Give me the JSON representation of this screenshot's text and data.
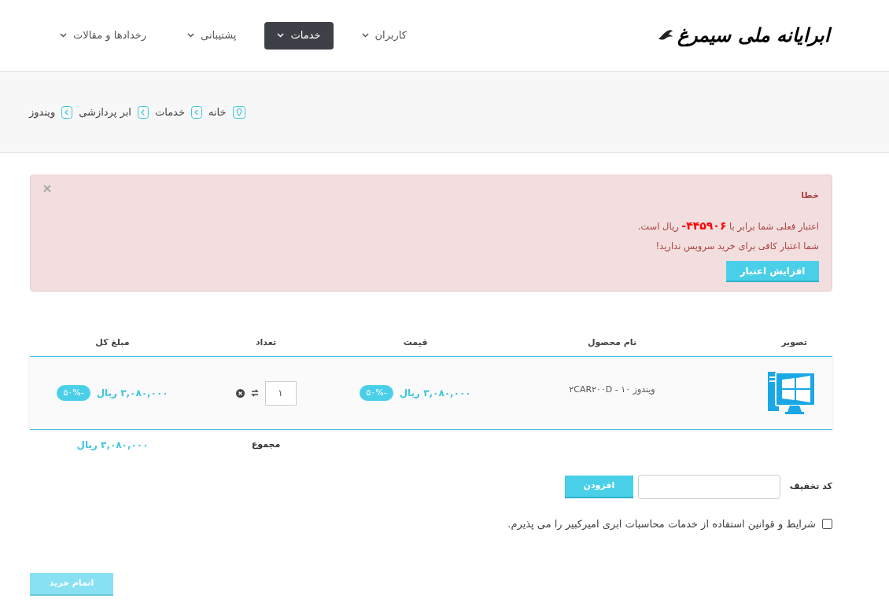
{
  "logo": {
    "text": "ابرایانه ملی سیمرغ"
  },
  "nav": [
    {
      "label": "کاربران",
      "selected": false
    },
    {
      "label": "خدمات",
      "selected": true
    },
    {
      "label": "پشتیبانی",
      "selected": false
    },
    {
      "label": "رخدادها و مقالات",
      "selected": false
    }
  ],
  "breadcrumb": [
    "خانه",
    "خدمات",
    "ابر پردازشی",
    "ویندوز"
  ],
  "alert": {
    "title": "خطا",
    "lines": [
      "اعتبار فعلی شما برابر با **۴۴۵۹۰۶-** ریال است.",
      "شما اعتبار کافی برای خرید سرویس ندارید!"
    ],
    "button": "افزایش اعتبار"
  },
  "table": {
    "columns": [
      "تصویر",
      "نام محصول",
      "قیمت",
      "تعداد",
      "مبلغ کل"
    ],
    "rows": [
      {
        "product": "ویندوز ۱۰ - ۲CAR۲۰۰D",
        "price": "۳,۰۸۰,۰۰۰ ریال",
        "price_badge": "-۵۰%",
        "quantity": "۱",
        "total": "۳,۰۸۰,۰۰۰ ریال",
        "total_badge": "-۵۰%"
      }
    ],
    "sum_label": "مجموع",
    "sum": "۳,۰۸۰,۰۰۰ ریال"
  },
  "discount": {
    "label": "کد تخفیف",
    "button": "افزودن"
  },
  "terms": {
    "label": "شرایط و قوانین استفاده از خدمات محاسبات ابری امیرکبیر را می پذیرم.",
    "checked": false
  },
  "submit": {
    "label": "اتمام خرید",
    "disabled": true
  }
}
